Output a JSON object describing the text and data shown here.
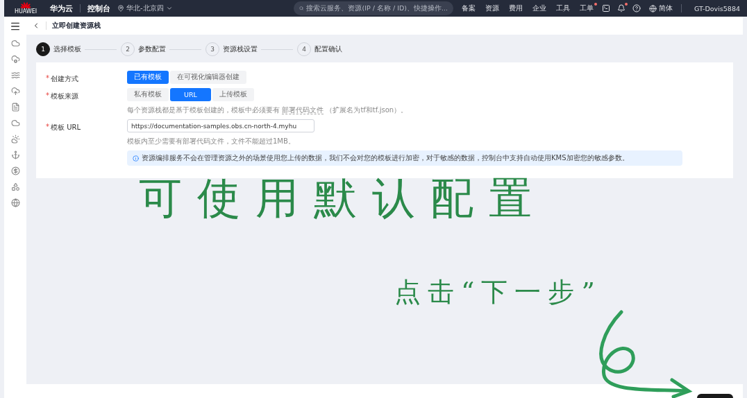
{
  "topbar": {
    "logo_text": "HUAWEI",
    "brand": "华为云",
    "console": "控制台",
    "region": "华北-北京四",
    "search_placeholder": "搜索云服务、资源(IP / 名称 / ID)、快捷操作...",
    "nav": [
      {
        "label": "备案",
        "notify": false
      },
      {
        "label": "资源",
        "notify": false
      },
      {
        "label": "费用",
        "notify": false
      },
      {
        "label": "企业",
        "notify": false
      },
      {
        "label": "工具",
        "notify": false
      },
      {
        "label": "工单",
        "notify": true
      }
    ],
    "bell_notify": true,
    "language": "简体",
    "user": "GT-Dovis5884"
  },
  "header": {
    "title": "立即创建资源栈"
  },
  "steps": [
    {
      "number": "1",
      "label": "选择模板",
      "selected": true
    },
    {
      "number": "2",
      "label": "参数配置",
      "selected": false
    },
    {
      "number": "3",
      "label": "资源栈设置",
      "selected": false
    },
    {
      "number": "4",
      "label": "配置确认",
      "selected": false
    }
  ],
  "form": [
    {
      "kind": "options",
      "required": true,
      "label": "创建方式",
      "options": [
        {
          "label": "已有模板",
          "selected": true
        },
        {
          "label": "在可视化编辑器创建",
          "selected": false
        }
      ]
    },
    {
      "kind": "options",
      "required": true,
      "label": "模板来源",
      "options": [
        {
          "label": "私有模板",
          "selected": false
        },
        {
          "label": "URL",
          "selected": true
        },
        {
          "label": "上传模板",
          "selected": false
        }
      ],
      "hint_before": "每个资源栈都是基于模板创建的，模板中必须要有",
      "hint_link": "部署代码文件",
      "hint_after": "（扩展名为tf和tf.json）。"
    },
    {
      "kind": "input",
      "required": true,
      "label": "模板 URL",
      "value": "https://documentation-samples.obs.cn-north-4.myhu",
      "hint": "模板内至少需要有部署代码文件，文件不能超过1MB。",
      "alert": "资源编排服务不会在管理资源之外的场景使用您上传的数据，我们不会对您的模板进行加密，对于敏感的数据，控制台中支持自动使用KMS加密您的敏感参数。"
    }
  ],
  "required_mark": "*",
  "annotations": [
    {
      "kind": "large",
      "text": "可使用默认配置"
    },
    {
      "kind": "medium",
      "text": "点击“下一步”"
    }
  ]
}
